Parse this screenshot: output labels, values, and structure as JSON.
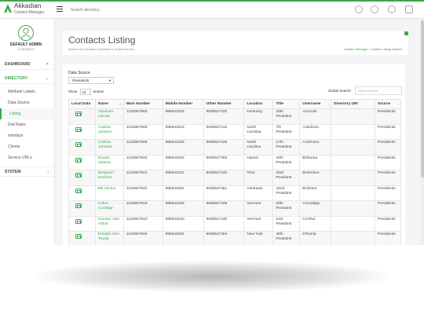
{
  "brand": {
    "title": "Akkadian",
    "subtitle": "Contact Manager"
  },
  "search": {
    "placeholder": "Search directory..."
  },
  "user": {
    "name": "DEFAULT ADMIN",
    "role": "CLADMIN ▾"
  },
  "sidebar": {
    "dashboard": "DASHBOARD",
    "directory": "DIRECTORY",
    "items": [
      {
        "label": "Attribute Labels"
      },
      {
        "label": "Data Source"
      },
      {
        "label": "Listing"
      },
      {
        "label": "Dial Rules"
      },
      {
        "label": "Interface"
      },
      {
        "label": "Clients"
      },
      {
        "label": "Service URLs"
      }
    ],
    "system": "SYSTEM"
  },
  "page": {
    "title": "Contacts Listing",
    "subtitle": "Search All Contacts Contained in Data Sources",
    "breadcrumb_home": "Contact Manager",
    "breadcrumb_sep": " / ",
    "breadcrumb_current": "Contact Listing Search"
  },
  "filters": {
    "data_source_label": "Data Source",
    "data_source_value": "Presidents",
    "show_label": "Show",
    "show_value": "10",
    "entries_label": "entries",
    "global_search_label": "Global Search:",
    "global_search_placeholder": "Global Search"
  },
  "table": {
    "columns": [
      "Local Data",
      "Name",
      "Main Number",
      "Mobile Number",
      "Other Number",
      "Location",
      "Title",
      "Username",
      "Directory URI",
      "Source"
    ],
    "rows": [
      {
        "name": "Abraham Lincoln",
        "main": "1234567905",
        "mobile": "986543225",
        "other": "9638527425",
        "location": "Kentucky",
        "title": "16th President",
        "username": "ALincoln",
        "uri": "",
        "source": "Presidents"
      },
      {
        "name": "Andrew Jackson",
        "main": "1234567906",
        "mobile": "986543216",
        "other": "9638527416",
        "location": "North Carolina",
        "title": "7th President",
        "username": "AJackson",
        "uri": "",
        "source": "Presidents"
      },
      {
        "name": "Andrew Johnson",
        "main": "1234567906",
        "mobile": "986543226",
        "other": "9638527426",
        "location": "North Carolina",
        "title": "17th President",
        "username": "AJohnson",
        "uri": "",
        "source": "Presidents"
      },
      {
        "name": "Barack Obama",
        "main": "1234567933",
        "mobile": "986543253",
        "other": "9638527453",
        "location": "Hawaii",
        "title": "44th President",
        "username": "BObama",
        "uri": "",
        "source": "Presidents"
      },
      {
        "name": "Benjamin Harrison",
        "main": "1234567912",
        "mobile": "986543232",
        "other": "9638527432",
        "location": "Ohio",
        "title": "23rd President",
        "username": "BHarrison",
        "uri": "",
        "source": "Presidents"
      },
      {
        "name": "Bill Clinton",
        "main": "1234567931",
        "mobile": "986543251",
        "other": "9638527451",
        "location": "Arkansas",
        "title": "42nd President",
        "username": "BClinton",
        "uri": "",
        "source": "Presidents"
      },
      {
        "name": "Calvin Coolidge",
        "main": "1234567919",
        "mobile": "986543239",
        "other": "9638527409",
        "location": "Vermont",
        "title": "30th President",
        "username": "CCoolidge",
        "uri": "",
        "source": "Presidents"
      },
      {
        "name": "Chester Alan Arthur",
        "main": "1234567910",
        "mobile": "986543230",
        "other": "9638527430",
        "location": "Vermont",
        "title": "21st President",
        "username": "CArthur",
        "uri": "",
        "source": "Presidents"
      },
      {
        "name": "Donald John Trump",
        "main": "1234567934",
        "mobile": "986543254",
        "other": "9638527454",
        "location": "New York",
        "title": "45th President",
        "username": "DTrump",
        "uri": "",
        "source": "Presidents"
      }
    ]
  },
  "colors": {
    "accent": "#3ca84a"
  }
}
